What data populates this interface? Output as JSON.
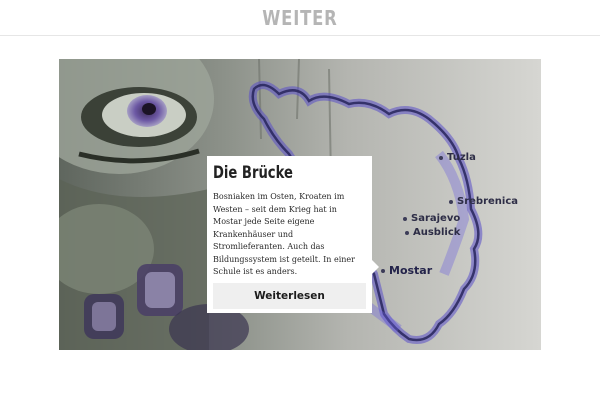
{
  "header": {
    "logo_text": "WEITER"
  },
  "hero": {
    "places": [
      {
        "name": "Tuzla"
      },
      {
        "name": "Srebrenica"
      },
      {
        "name": "Sarajevo"
      },
      {
        "name": "Ausblick"
      },
      {
        "name": "Mostar"
      }
    ]
  },
  "card": {
    "title": "Die Brücke",
    "text": "Bosniaken im Osten, Kroaten im Westen – seit dem Krieg hat in Mostar jede Seite eigene Krankenhäuser und Stromlieferanten. Auch das Bildungssystem ist geteilt. In einer Schule ist es anders.",
    "button_label": "Weiterlesen"
  },
  "colors": {
    "accent": "#5a4fc8",
    "logo": "#b5b5b5",
    "button_bg": "#efefef"
  }
}
